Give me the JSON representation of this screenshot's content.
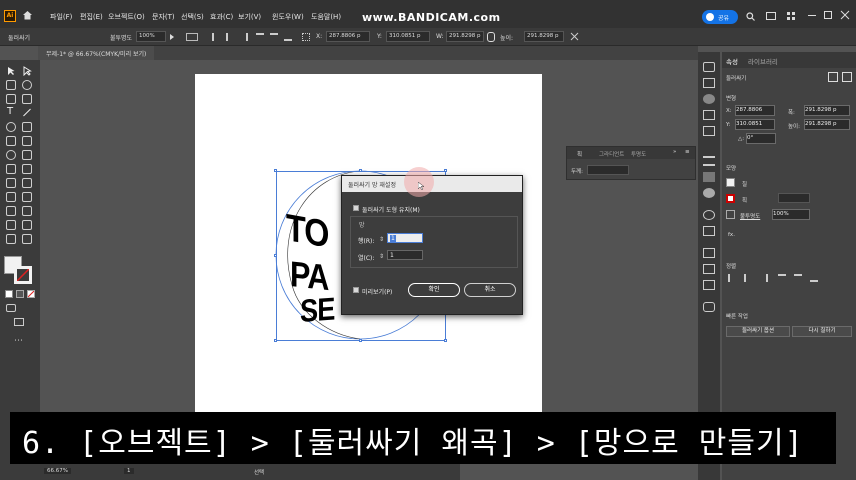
{
  "app": {
    "logo": "Ai"
  },
  "menu": [
    "파일(F)",
    "편집(E)",
    "오브젝트(O)",
    "문자(T)",
    "선택(S)",
    "효과(C)",
    "보기(V)",
    "윈도우(W)",
    "도움말(H)"
  ],
  "watermark": "www.BANDICAM.com",
  "share_label": "공유",
  "controlbar": {
    "object_label": "둘러싸기",
    "opacity_label": "불투명도",
    "opacity_value": "100%",
    "x_label": "X:",
    "x_value": "287.8806 p",
    "y_label": "Y:",
    "y_value": "310.0851 p",
    "w_label": "W:",
    "w_value": "291.8298 p",
    "h_label": "높이:",
    "h_value": "291.8298 p"
  },
  "document_tab": "무제-1* @ 66.67%(CMYK/미리 보기)",
  "artwork_text": [
    "TO",
    "PA",
    "SE"
  ],
  "float_panel": {
    "tabs": [
      "획",
      "그라디언트",
      "투명도"
    ],
    "row_label": "두께:"
  },
  "dialog": {
    "title": "둘러싸기 망 재설정",
    "preserve_label": "둘러싸기 도형 유지(M)",
    "group_label": "망",
    "rows_label": "행(R):",
    "rows_value": "1",
    "cols_label": "열(C):",
    "cols_value": "1",
    "preview_label": "미리보기(P)",
    "ok_label": "확인",
    "cancel_label": "취소"
  },
  "right_panel": {
    "tabs": [
      "속성",
      "라이브러리"
    ],
    "object_label": "둘러싸기",
    "transform_header": "변형",
    "x_label": "X:",
    "x_value": "287.8806",
    "y_label": "Y:",
    "y_value": "310.0851",
    "w_label": "폭:",
    "w_value": "291.8298 p",
    "h_label": "높이:",
    "h_value": "291.8298 p",
    "angle_label": "△:",
    "angle_value": "0°",
    "appearance_header": "모양",
    "fill_label": "칠",
    "stroke_label": "획",
    "opacity_label": "불투명도",
    "opacity_value": "100%",
    "fx_label": "fx.",
    "align_header": "정렬",
    "quick_actions_header": "빠른 작업",
    "envelope_options_button": "둘러싸기 옵션",
    "re_envelope_button": "다시 칠하기"
  },
  "statusbar": {
    "zoom": "66.67%",
    "page": "1",
    "mode": "선택"
  },
  "caption": "6. [오브젝트] > [둘러싸기 왜곡] > [망으로 만들기]",
  "colors": {
    "accent": "#4a7dd6",
    "bg": "#535353",
    "panel": "#424242"
  }
}
